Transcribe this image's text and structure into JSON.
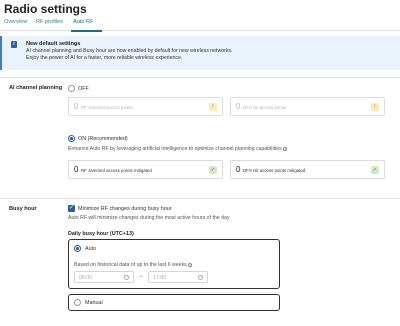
{
  "page": {
    "title": "Radio settings"
  },
  "tabs": [
    {
      "label": "Overview"
    },
    {
      "label": "RF profiles"
    },
    {
      "label": "Auto RF",
      "active": true
    }
  ],
  "banner": {
    "icon": "info-icon",
    "title": "New default settings",
    "lines": [
      "AI channel planning and Busy hour are now enabled by default for new wireless networks.",
      "Enjoy the power of AI for a faster, more reliable wireless experience."
    ]
  },
  "ai_channel_planning": {
    "label": "AI channel planning",
    "off_option": {
      "label": "OFF",
      "selected": false
    },
    "off_stats": [
      {
        "value": "0",
        "label": "RF Jammed access points",
        "badge_icon": "warning-icon"
      },
      {
        "value": "0",
        "label": "DFS Hit access points",
        "badge_icon": "warning-icon"
      }
    ],
    "on_option": {
      "label": "ON (Recommended)",
      "selected": true
    },
    "on_description": "Enhance Auto RF by leveraging artificial intelligence to optimize channel planning capabilities",
    "on_stats": [
      {
        "value": "0",
        "label": "RF Jammed access points mitigated",
        "badge_icon": "check-icon"
      },
      {
        "value": "0",
        "label": "DFS Hit access points mitigated",
        "badge_icon": "check-icon"
      }
    ]
  },
  "busy_hour": {
    "label": "Busy hour",
    "checkbox": {
      "label": "Minimize RF changes during busy hour",
      "checked": true
    },
    "description": "Auto RF will minimize changes during the most active hours of the day",
    "daily_title": "Daily busy hour (UTC+13)",
    "auto_option": {
      "label": "Auto",
      "selected": true,
      "hint": "Based on historical data of up to the last 6 weeks",
      "start": "08:00",
      "end": "17:00"
    },
    "manual_option": {
      "label": "Manual",
      "selected": false
    }
  },
  "colors": {
    "accent": "#2a5fa5",
    "banner_bg": "#eaf3fb",
    "warning_badge": "#fbe9b8",
    "success_badge": "#cfe8c9"
  }
}
